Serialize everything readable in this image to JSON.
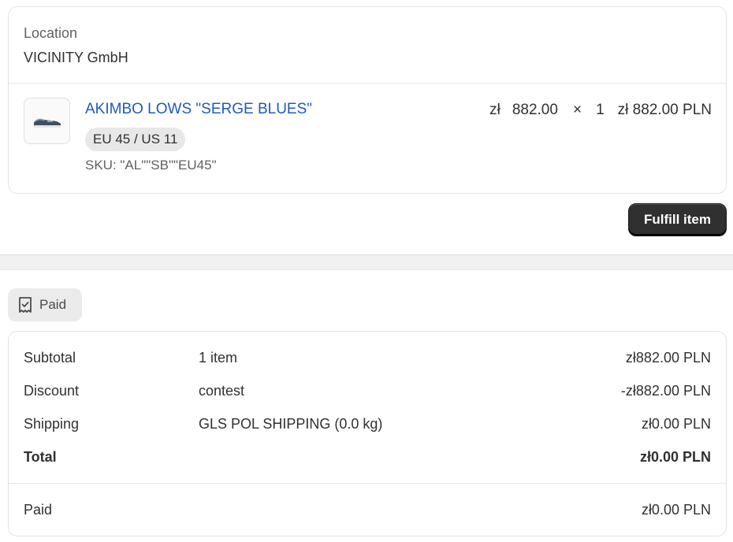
{
  "location": {
    "label": "Location",
    "name": "VICINITY GmbH"
  },
  "line_item": {
    "thumbnail_icon": "sneaker-image",
    "title": "AKIMBO LOWS \"SERGE BLUES\"",
    "variant": "EU 45 / US 11",
    "sku": "SKU: \"AL\"\"SB\"\"EU45\"",
    "currency_symbol": "zł",
    "unit_price": "882.00",
    "times": "×",
    "quantity": "1",
    "line_total": "zł 882.00 PLN"
  },
  "fulfill_button": "Fulfill item",
  "payment": {
    "badge_icon": "receipt-check-icon",
    "badge_label": "Paid",
    "rows": [
      {
        "label": "Subtotal",
        "detail": "1 item",
        "amount": "zł882.00 PLN"
      },
      {
        "label": "Discount",
        "detail": "contest",
        "amount": "-zł882.00 PLN"
      },
      {
        "label": "Shipping",
        "detail": "GLS POL SHIPPING (0.0 kg)",
        "amount": "zł0.00 PLN"
      }
    ],
    "total": {
      "label": "Total",
      "amount": "zł0.00 PLN"
    },
    "paid": {
      "label": "Paid",
      "amount": "zł0.00 PLN"
    }
  }
}
